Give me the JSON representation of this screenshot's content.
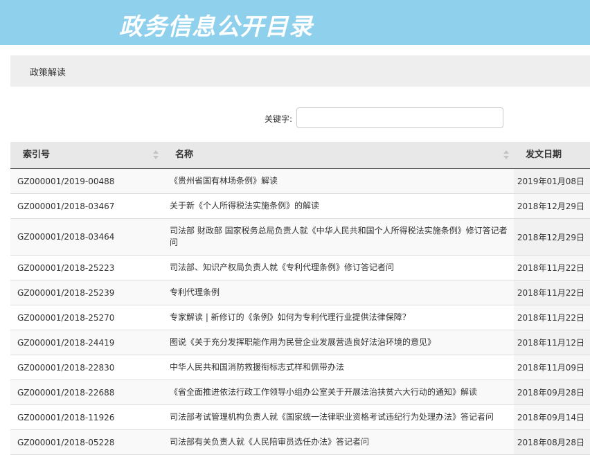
{
  "header": {
    "title": "政务信息公开目录"
  },
  "breadcrumb": {
    "label": "政策解读"
  },
  "search": {
    "label": "关键字:",
    "value": "",
    "placeholder": ""
  },
  "table": {
    "columns": [
      "索引号",
      "名称",
      "发文日期"
    ],
    "rows": [
      {
        "id": "GZ000001/2019-00488",
        "name": "《贵州省国有林场条例》解读",
        "date": "2019年01月08日"
      },
      {
        "id": "GZ000001/2018-03467",
        "name": "关于新《个人所得税法实施条例》的解读",
        "date": "2018年12月29日"
      },
      {
        "id": "GZ000001/2018-03464",
        "name": "司法部 财政部 国家税务总局负责人就《中华人民共和国个人所得税法实施条例》修订答记者问",
        "date": "2018年12月29日"
      },
      {
        "id": "GZ000001/2018-25223",
        "name": "司法部、知识产权局负责人就《专利代理条例》修订答记者问",
        "date": "2018年11月22日"
      },
      {
        "id": "GZ000001/2018-25239",
        "name": "专利代理条例",
        "date": "2018年11月22日"
      },
      {
        "id": "GZ000001/2018-25270",
        "name": "专家解读 | 新修订的《条例》如何为专利代理行业提供法律保障？",
        "date": "2018年11月22日"
      },
      {
        "id": "GZ000001/2018-24419",
        "name": "图说《关于充分发挥职能作用为民营企业发展营造良好法治环境的意见》",
        "date": "2018年11月12日"
      },
      {
        "id": "GZ000001/2018-22830",
        "name": "中华人民共和国消防救援衔标志式样和佩带办法",
        "date": "2018年11月09日"
      },
      {
        "id": "GZ000001/2018-22688",
        "name": "《省全面推进依法行政工作领导小组办公室关于开展法治扶贫六大行动的通知》解读",
        "date": "2018年09月28日"
      },
      {
        "id": "GZ000001/2018-11926",
        "name": "司法部考试管理机构负责人就《国家统一法律职业资格考试违纪行为处理办法》答记者问",
        "date": "2018年09月14日"
      },
      {
        "id": "GZ000001/2018-05228",
        "name": "司法部有关负责人就《人民陪审员选任办法》答记者问",
        "date": "2018年08月28日"
      }
    ]
  },
  "colors": {
    "banner": "#8fd0ec",
    "banner_text": "#ffffff",
    "crumb_bg": "#eeeeee",
    "header_bg": "#e8e8e8"
  }
}
